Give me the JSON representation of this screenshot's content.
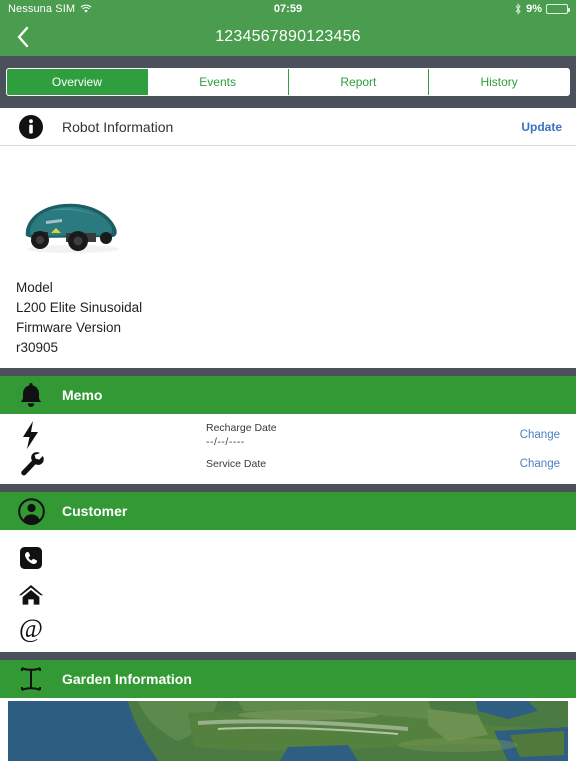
{
  "statusbar": {
    "carrier": "Nessuna SIM",
    "wifi_icon": "wifi-icon",
    "time": "07:59",
    "bluetooth_icon": "bluetooth-icon",
    "battery_percent": "9%",
    "battery_level": 9,
    "battery_icon": "battery-low-icon"
  },
  "navbar": {
    "back_icon": "chevron-left-icon",
    "title": "1234567890123456"
  },
  "tabs": [
    {
      "label": "Overview",
      "active": true
    },
    {
      "label": "Events",
      "active": false
    },
    {
      "label": "Report",
      "active": false
    },
    {
      "label": "History",
      "active": false
    }
  ],
  "robot_information": {
    "icon": "info-circle-icon",
    "title": "Robot Information",
    "update_label": "Update",
    "image_alt": "robot-lawnmower-photo",
    "model_label": "Model",
    "model_value": "L200 Elite Sinusoidal",
    "firmware_label": "Firmware Version",
    "firmware_value": "r30905"
  },
  "memo": {
    "icon": "bell-icon",
    "title": "Memo",
    "rows": [
      {
        "icon": "lightning-bolt-icon",
        "label": "Recharge Date",
        "value": "--/--/----",
        "action": "Change"
      },
      {
        "icon": "wrench-icon",
        "label": "Service Date",
        "value": "",
        "action": "Change"
      }
    ]
  },
  "customer": {
    "icon": "person-circle-icon",
    "title": "Customer",
    "rows": [
      {
        "icon": "phone-icon",
        "value": ""
      },
      {
        "icon": "home-icon",
        "value": ""
      },
      {
        "icon": "email-at-icon",
        "value": ""
      }
    ]
  },
  "garden_information": {
    "icon": "area-measure-icon",
    "title": "Garden Information",
    "map_alt": "satellite-map-europe"
  },
  "colors": {
    "nav_green": "#4a9c4e",
    "tab_green": "#2f9e3e",
    "section_green": "#339934",
    "dark_slate": "#4b505a",
    "link_blue": "#3a72c0",
    "battery_red": "#e8483c"
  }
}
